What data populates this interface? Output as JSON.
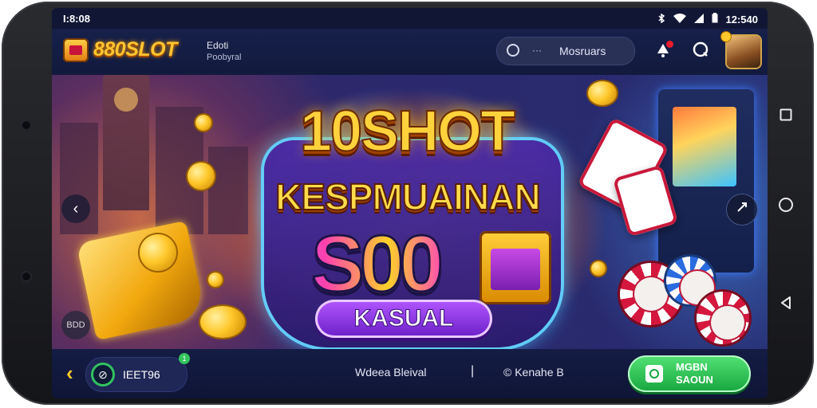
{
  "status_bar": {
    "time": "I:8:08",
    "clock": "12:540"
  },
  "header": {
    "brand": "880SLOT",
    "sub_line1": "Edoti",
    "sub_line2": "Poobyral",
    "search_dots": "···",
    "search_text": "Mosruars"
  },
  "banner": {
    "title_line1": "10SHOT",
    "title_line2": "KESPMUAINAN",
    "title_line3": "S00",
    "tag": "KASUAL",
    "chip_text": "BDD"
  },
  "bottom": {
    "user_name": "IEET96",
    "badge": "1",
    "text_left": "Wdeea Bleival",
    "separator": "|",
    "text_right": "© Kenahe B",
    "cta_line1": "MGBN",
    "cta_line2": "SAOUN"
  },
  "colors": {
    "accent_gold": "#ffc530",
    "cta_green": "#2ec455",
    "bg_dark": "#101634"
  },
  "icons": [
    "wifi-icon",
    "signal-icon",
    "battery-icon",
    "search-icon",
    "notification-icon",
    "chat-icon",
    "avatar",
    "chevron-left-icon",
    "chevron-right-icon",
    "back-icon",
    "home-icon",
    "recents-icon"
  ]
}
